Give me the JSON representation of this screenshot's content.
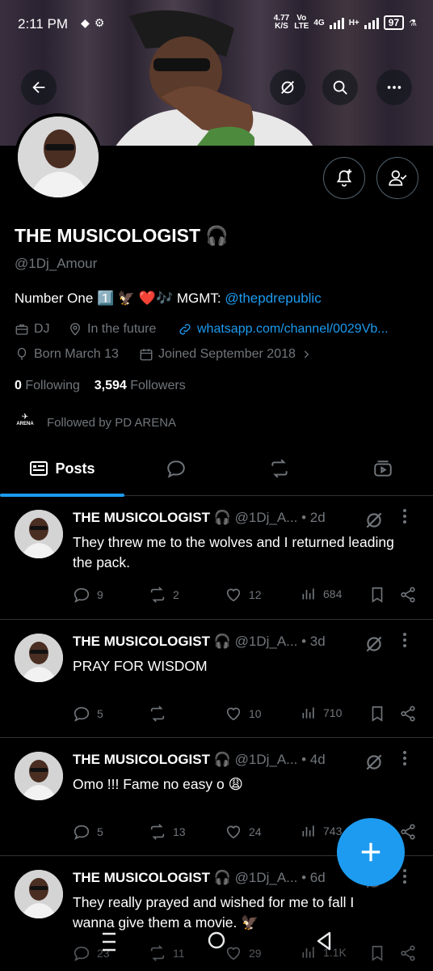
{
  "status_bar": {
    "time": "2:11 PM",
    "net_speed_value": "4.77",
    "net_speed_unit": "K/S",
    "volte_top": "Vo",
    "volte_bottom": "LTE",
    "network_1": "4G",
    "network_2": "H+",
    "battery": "97"
  },
  "profile": {
    "name": "THE MUSICOLOGIST 🎧",
    "handle": "@1Dj_Amour",
    "bio_text": "Number One 1️⃣ 🦅 ❤️🎶 MGMT: ",
    "bio_link": "@thepdrepublic",
    "category": "DJ",
    "location": "In the future",
    "website": "whatsapp.com/channel/0029Vb...",
    "birthday": "Born March 13",
    "joined": "Joined September 2018",
    "following_count": "0",
    "following_label": "Following",
    "followers_count": "3,594",
    "followers_label": "Followers",
    "followed_by": "Followed by PD ARENA",
    "followed_by_logo": "ARENA"
  },
  "tabs": {
    "posts_label": "Posts"
  },
  "posts": [
    {
      "name": "THE MUSICOLOGIST 🎧",
      "handle": "@1Dj_A...",
      "time": "• 2d",
      "text": "They threw me to the wolves and I returned leading the pack.",
      "replies": "9",
      "reposts": "2",
      "likes": "12",
      "views": "684"
    },
    {
      "name": "THE MUSICOLOGIST 🎧",
      "handle": "@1Dj_A...",
      "time": "• 3d",
      "text": "PRAY FOR WISDOM",
      "replies": "5",
      "reposts": "",
      "likes": "10",
      "views": "710"
    },
    {
      "name": "THE MUSICOLOGIST 🎧",
      "handle": "@1Dj_A...",
      "time": "• 4d",
      "text": "Omo !!! Fame no easy o 😩",
      "replies": "5",
      "reposts": "13",
      "likes": "24",
      "views": "743"
    },
    {
      "name": "THE MUSICOLOGIST 🎧",
      "handle": "@1Dj_A...",
      "time": "• 6d",
      "text": "They really prayed and wished for me to fall I wanna give them a movie. 🦅",
      "replies": "23",
      "reposts": "11",
      "likes": "29",
      "views": "1.1K"
    }
  ],
  "colors": {
    "accent": "#1d9bf0",
    "background": "#000000",
    "muted_text": "#71767b",
    "divider": "#2f3336"
  },
  "icons": [
    "back-arrow-icon",
    "grok-icon",
    "search-icon",
    "more-icon",
    "notification-bell-icon",
    "follow-user-icon",
    "briefcase-icon",
    "location-pin-icon",
    "link-icon",
    "balloon-icon",
    "calendar-icon",
    "chevron-right-icon",
    "posts-icon",
    "chat-bubble-icon",
    "repost-icon",
    "media-icon",
    "reply-icon",
    "like-icon",
    "views-icon",
    "bookmark-icon",
    "share-icon",
    "plus-icon"
  ]
}
